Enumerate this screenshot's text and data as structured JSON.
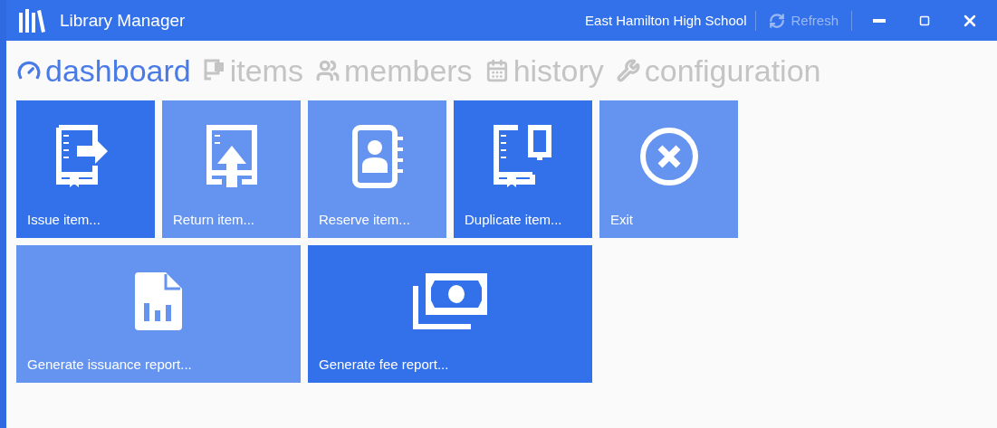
{
  "window": {
    "title": "Library Manager",
    "school": "East Hamilton High School",
    "refresh": "Refresh",
    "refresh_disabled": true
  },
  "tabs": [
    {
      "label": "dashboard",
      "selected": true
    },
    {
      "label": "items",
      "selected": false
    },
    {
      "label": "members",
      "selected": false
    },
    {
      "label": "history",
      "selected": false
    },
    {
      "label": "configuration",
      "selected": false
    }
  ],
  "tiles": [
    {
      "label": "Issue item...",
      "kind": "small",
      "color": "#3271ea"
    },
    {
      "label": "Return item...",
      "kind": "small",
      "color": "#6594f0"
    },
    {
      "label": "Reserve item...",
      "kind": "small",
      "color": "#6594f0"
    },
    {
      "label": "Duplicate item...",
      "kind": "small",
      "color": "#3271ea"
    },
    {
      "label": "Exit",
      "kind": "small",
      "color": "#6594f0"
    },
    {
      "label": "Generate issuance report...",
      "kind": "wide",
      "color": "#6594f0"
    },
    {
      "label": "Generate fee report...",
      "kind": "wide",
      "color": "#3271ea"
    }
  ]
}
